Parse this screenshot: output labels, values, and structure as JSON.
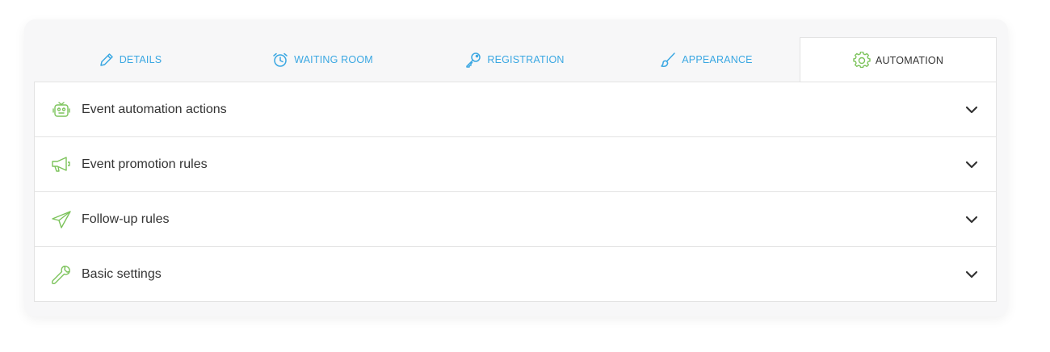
{
  "tabs": [
    {
      "label": "DETAILS",
      "icon": "pencil-icon",
      "active": false
    },
    {
      "label": "WAITING ROOM",
      "icon": "alarm-clock-icon",
      "active": false
    },
    {
      "label": "REGISTRATION",
      "icon": "key-icon",
      "active": false
    },
    {
      "label": "APPEARANCE",
      "icon": "brush-icon",
      "active": false
    },
    {
      "label": "AUTOMATION",
      "icon": "gear-icon",
      "active": true
    }
  ],
  "sections": [
    {
      "label": "Event automation actions",
      "icon": "robot-icon"
    },
    {
      "label": "Event promotion rules",
      "icon": "megaphone-icon"
    },
    {
      "label": "Follow-up rules",
      "icon": "paper-plane-icon"
    },
    {
      "label": "Basic settings",
      "icon": "wrench-icon"
    }
  ],
  "colors": {
    "tab_text": "#3aa7e2",
    "active_tab_text": "#333333",
    "section_icon": "#7cc35b",
    "chevron": "#333333"
  }
}
